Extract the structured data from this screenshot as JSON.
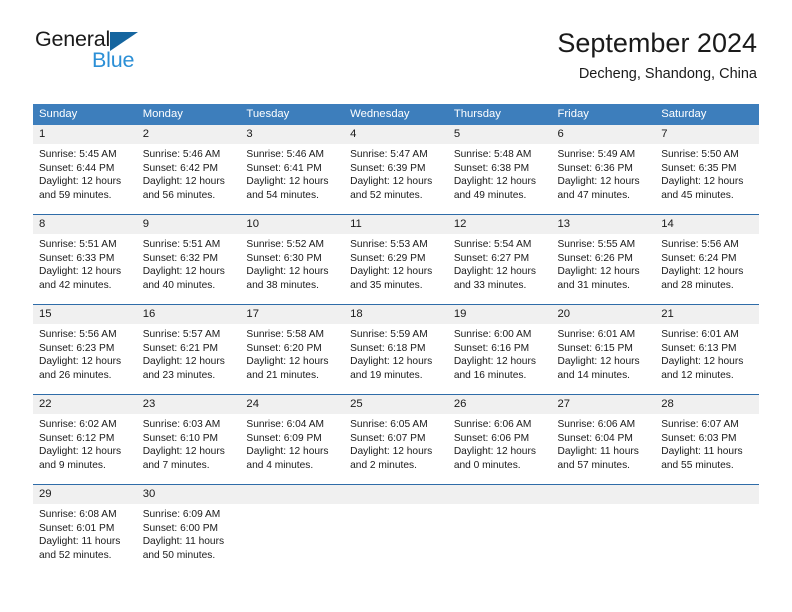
{
  "brand": {
    "name_part1": "General",
    "name_part2": "Blue",
    "logo_icon": "triangle-logo-icon",
    "accent_dark": "#15659f",
    "accent_light": "#2b8fd6"
  },
  "header": {
    "title": "September 2024",
    "subtitle": "Decheng, Shandong, China"
  },
  "theme": {
    "header_blue": "#3d7ebc",
    "row_divider_blue": "#2f6ca8",
    "daynum_band_gray": "#f0f0f0",
    "text_color": "#1a1a1a"
  },
  "calendar": {
    "weekdays": [
      "Sunday",
      "Monday",
      "Tuesday",
      "Wednesday",
      "Thursday",
      "Friday",
      "Saturday"
    ],
    "weeks": [
      {
        "days": [
          {
            "num": "1",
            "sunrise": "Sunrise: 5:45 AM",
            "sunset": "Sunset: 6:44 PM",
            "daylight": "Daylight: 12 hours and 59 minutes."
          },
          {
            "num": "2",
            "sunrise": "Sunrise: 5:46 AM",
            "sunset": "Sunset: 6:42 PM",
            "daylight": "Daylight: 12 hours and 56 minutes."
          },
          {
            "num": "3",
            "sunrise": "Sunrise: 5:46 AM",
            "sunset": "Sunset: 6:41 PM",
            "daylight": "Daylight: 12 hours and 54 minutes."
          },
          {
            "num": "4",
            "sunrise": "Sunrise: 5:47 AM",
            "sunset": "Sunset: 6:39 PM",
            "daylight": "Daylight: 12 hours and 52 minutes."
          },
          {
            "num": "5",
            "sunrise": "Sunrise: 5:48 AM",
            "sunset": "Sunset: 6:38 PM",
            "daylight": "Daylight: 12 hours and 49 minutes."
          },
          {
            "num": "6",
            "sunrise": "Sunrise: 5:49 AM",
            "sunset": "Sunset: 6:36 PM",
            "daylight": "Daylight: 12 hours and 47 minutes."
          },
          {
            "num": "7",
            "sunrise": "Sunrise: 5:50 AM",
            "sunset": "Sunset: 6:35 PM",
            "daylight": "Daylight: 12 hours and 45 minutes."
          }
        ]
      },
      {
        "days": [
          {
            "num": "8",
            "sunrise": "Sunrise: 5:51 AM",
            "sunset": "Sunset: 6:33 PM",
            "daylight": "Daylight: 12 hours and 42 minutes."
          },
          {
            "num": "9",
            "sunrise": "Sunrise: 5:51 AM",
            "sunset": "Sunset: 6:32 PM",
            "daylight": "Daylight: 12 hours and 40 minutes."
          },
          {
            "num": "10",
            "sunrise": "Sunrise: 5:52 AM",
            "sunset": "Sunset: 6:30 PM",
            "daylight": "Daylight: 12 hours and 38 minutes."
          },
          {
            "num": "11",
            "sunrise": "Sunrise: 5:53 AM",
            "sunset": "Sunset: 6:29 PM",
            "daylight": "Daylight: 12 hours and 35 minutes."
          },
          {
            "num": "12",
            "sunrise": "Sunrise: 5:54 AM",
            "sunset": "Sunset: 6:27 PM",
            "daylight": "Daylight: 12 hours and 33 minutes."
          },
          {
            "num": "13",
            "sunrise": "Sunrise: 5:55 AM",
            "sunset": "Sunset: 6:26 PM",
            "daylight": "Daylight: 12 hours and 31 minutes."
          },
          {
            "num": "14",
            "sunrise": "Sunrise: 5:56 AM",
            "sunset": "Sunset: 6:24 PM",
            "daylight": "Daylight: 12 hours and 28 minutes."
          }
        ]
      },
      {
        "days": [
          {
            "num": "15",
            "sunrise": "Sunrise: 5:56 AM",
            "sunset": "Sunset: 6:23 PM",
            "daylight": "Daylight: 12 hours and 26 minutes."
          },
          {
            "num": "16",
            "sunrise": "Sunrise: 5:57 AM",
            "sunset": "Sunset: 6:21 PM",
            "daylight": "Daylight: 12 hours and 23 minutes."
          },
          {
            "num": "17",
            "sunrise": "Sunrise: 5:58 AM",
            "sunset": "Sunset: 6:20 PM",
            "daylight": "Daylight: 12 hours and 21 minutes."
          },
          {
            "num": "18",
            "sunrise": "Sunrise: 5:59 AM",
            "sunset": "Sunset: 6:18 PM",
            "daylight": "Daylight: 12 hours and 19 minutes."
          },
          {
            "num": "19",
            "sunrise": "Sunrise: 6:00 AM",
            "sunset": "Sunset: 6:16 PM",
            "daylight": "Daylight: 12 hours and 16 minutes."
          },
          {
            "num": "20",
            "sunrise": "Sunrise: 6:01 AM",
            "sunset": "Sunset: 6:15 PM",
            "daylight": "Daylight: 12 hours and 14 minutes."
          },
          {
            "num": "21",
            "sunrise": "Sunrise: 6:01 AM",
            "sunset": "Sunset: 6:13 PM",
            "daylight": "Daylight: 12 hours and 12 minutes."
          }
        ]
      },
      {
        "days": [
          {
            "num": "22",
            "sunrise": "Sunrise: 6:02 AM",
            "sunset": "Sunset: 6:12 PM",
            "daylight": "Daylight: 12 hours and 9 minutes."
          },
          {
            "num": "23",
            "sunrise": "Sunrise: 6:03 AM",
            "sunset": "Sunset: 6:10 PM",
            "daylight": "Daylight: 12 hours and 7 minutes."
          },
          {
            "num": "24",
            "sunrise": "Sunrise: 6:04 AM",
            "sunset": "Sunset: 6:09 PM",
            "daylight": "Daylight: 12 hours and 4 minutes."
          },
          {
            "num": "25",
            "sunrise": "Sunrise: 6:05 AM",
            "sunset": "Sunset: 6:07 PM",
            "daylight": "Daylight: 12 hours and 2 minutes."
          },
          {
            "num": "26",
            "sunrise": "Sunrise: 6:06 AM",
            "sunset": "Sunset: 6:06 PM",
            "daylight": "Daylight: 12 hours and 0 minutes."
          },
          {
            "num": "27",
            "sunrise": "Sunrise: 6:06 AM",
            "sunset": "Sunset: 6:04 PM",
            "daylight": "Daylight: 11 hours and 57 minutes."
          },
          {
            "num": "28",
            "sunrise": "Sunrise: 6:07 AM",
            "sunset": "Sunset: 6:03 PM",
            "daylight": "Daylight: 11 hours and 55 minutes."
          }
        ]
      },
      {
        "days": [
          {
            "num": "29",
            "sunrise": "Sunrise: 6:08 AM",
            "sunset": "Sunset: 6:01 PM",
            "daylight": "Daylight: 11 hours and 52 minutes."
          },
          {
            "num": "30",
            "sunrise": "Sunrise: 6:09 AM",
            "sunset": "Sunset: 6:00 PM",
            "daylight": "Daylight: 11 hours and 50 minutes."
          },
          {
            "num": "",
            "sunrise": "",
            "sunset": "",
            "daylight": ""
          },
          {
            "num": "",
            "sunrise": "",
            "sunset": "",
            "daylight": ""
          },
          {
            "num": "",
            "sunrise": "",
            "sunset": "",
            "daylight": ""
          },
          {
            "num": "",
            "sunrise": "",
            "sunset": "",
            "daylight": ""
          },
          {
            "num": "",
            "sunrise": "",
            "sunset": "",
            "daylight": ""
          }
        ]
      }
    ]
  }
}
